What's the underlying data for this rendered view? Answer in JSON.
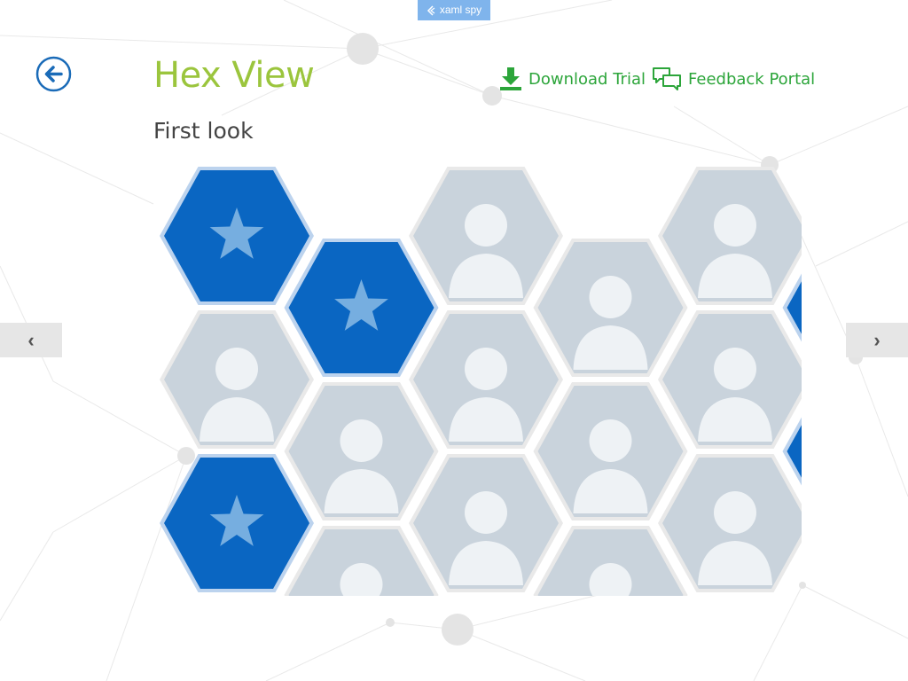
{
  "badge": {
    "label": "xaml spy"
  },
  "header": {
    "title": "Hex View",
    "subtitle": "First look",
    "download_label": "Download Trial",
    "feedback_label": "Feedback Portal"
  },
  "nav": {
    "prev_glyph": "‹",
    "next_glyph": "›"
  },
  "colors": {
    "title": "#9bc53d",
    "link": "#2ca53a",
    "hex_blue": "#0a66c2",
    "star": "#76aee0",
    "back_icon": "#1a6bb8",
    "badge": "#7fb4ec"
  },
  "icons": {
    "back": "back-arrow-icon",
    "download": "download-icon",
    "feedback": "feedback-icon",
    "prev": "chevron-left-icon",
    "next": "chevron-right-icon",
    "tile_star": "star-icon"
  },
  "tiles": [
    {
      "kind": "star"
    },
    {
      "kind": "photo"
    },
    {
      "kind": "star"
    },
    {
      "kind": "star"
    },
    {
      "kind": "photo"
    },
    {
      "kind": "photo"
    },
    {
      "kind": "photo"
    },
    {
      "kind": "photo"
    },
    {
      "kind": "photo"
    },
    {
      "kind": "photo"
    },
    {
      "kind": "photo"
    },
    {
      "kind": "photo"
    },
    {
      "kind": "photo"
    },
    {
      "kind": "photo"
    },
    {
      "kind": "photo"
    },
    {
      "kind": "star"
    },
    {
      "kind": "star"
    }
  ]
}
